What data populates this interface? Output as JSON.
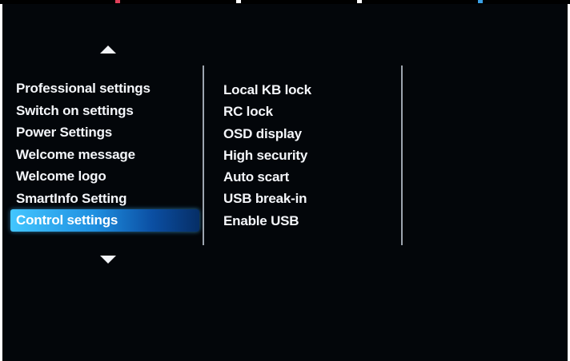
{
  "colors": {
    "background": "#03060a",
    "text": "#f4f6fa",
    "selection_accent": "#1f8fe0",
    "top_marks": [
      "#e0405a",
      "#ffffff",
      "#ffffff",
      "#3aa0e6"
    ]
  },
  "icons": {
    "scroll_up": "triangle-up-icon",
    "scroll_down": "triangle-down-icon"
  },
  "left_menu": {
    "selected_index": 6,
    "items": [
      {
        "label": "Professional settings"
      },
      {
        "label": "Switch on settings"
      },
      {
        "label": "Power Settings"
      },
      {
        "label": "Welcome message"
      },
      {
        "label": "Welcome logo"
      },
      {
        "label": "SmartInfo Setting"
      },
      {
        "label": "Control settings"
      }
    ]
  },
  "right_menu": {
    "items": [
      {
        "label": "Local KB lock"
      },
      {
        "label": "RC lock"
      },
      {
        "label": "OSD display"
      },
      {
        "label": "High security"
      },
      {
        "label": "Auto scart"
      },
      {
        "label": "USB break-in"
      },
      {
        "label": "Enable USB"
      }
    ]
  }
}
